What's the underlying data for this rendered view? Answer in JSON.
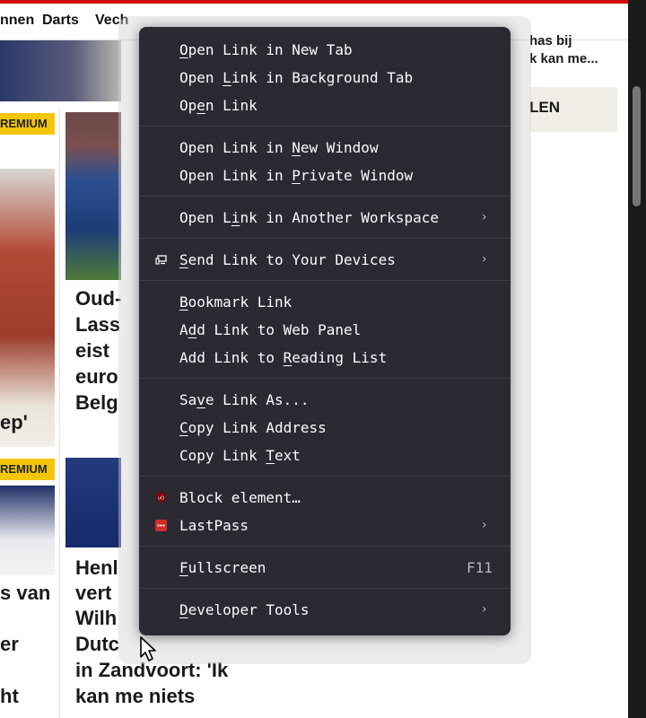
{
  "nav": {
    "items": [
      "nnen",
      "Darts",
      "Vech"
    ]
  },
  "background": {
    "premium_badge": "REMIUM",
    "premium_badge_2": "REMIUM",
    "sidebar_snippet_1": "has bij",
    "sidebar_snippet_2": "k kan me...",
    "sidebar_button_fragment": "LEN",
    "article_headline_fragments": [
      "Oud-",
      "Lass",
      "eist",
      "euro",
      "Belg"
    ],
    "left_headline_fragment": "ep'",
    "article2_headline_fragments": [
      "Henl",
      "vert",
      "Wilh",
      "Dutc",
      "in Zandvoort: 'Ik",
      "kan me niets"
    ],
    "left2_headline_fragments": [
      "s van",
      "er",
      "ht"
    ]
  },
  "context_menu": {
    "items": [
      {
        "id": "open-new-tab",
        "pre": "",
        "u": "O",
        "post": "pen Link in New Tab"
      },
      {
        "id": "open-background-tab",
        "pre": "Open ",
        "u": "L",
        "post": "ink in Background Tab"
      },
      {
        "id": "open-link",
        "pre": "Op",
        "u": "e",
        "post": "n Link"
      },
      {
        "id": "open-new-window",
        "pre": "Open Link in ",
        "u": "N",
        "post": "ew Window"
      },
      {
        "id": "open-private-window",
        "pre": "Open Link in ",
        "u": "P",
        "post": "rivate Window"
      },
      {
        "id": "open-another-workspace",
        "pre": "Open L",
        "u": "i",
        "post": "nk in Another Workspace"
      },
      {
        "id": "send-link-devices",
        "pre": "",
        "u": "S",
        "post": "end Link to Your Devices"
      },
      {
        "id": "bookmark-link",
        "pre": "",
        "u": "B",
        "post": "ookmark Link"
      },
      {
        "id": "add-web-panel",
        "pre": "A",
        "u": "d",
        "post": "d Link to Web Panel"
      },
      {
        "id": "add-reading-list",
        "pre": "Add Link to ",
        "u": "R",
        "post": "eading List"
      },
      {
        "id": "save-link-as",
        "pre": "Sa",
        "u": "v",
        "post": "e Link As..."
      },
      {
        "id": "copy-link-address",
        "pre": "",
        "u": "C",
        "post": "opy Link Address"
      },
      {
        "id": "copy-link-text",
        "pre": "Copy Link ",
        "u": "T",
        "post": "ext"
      },
      {
        "id": "block-element",
        "pre": "Block element…",
        "u": "",
        "post": ""
      },
      {
        "id": "lastpass",
        "pre": "LastPass",
        "u": "",
        "post": ""
      },
      {
        "id": "fullscreen",
        "pre": "",
        "u": "F",
        "post": "ullscreen"
      },
      {
        "id": "developer-tools",
        "pre": "",
        "u": "D",
        "post": "eveloper Tools"
      }
    ],
    "submenu_arrow": "›",
    "fullscreen_shortcut": "F11"
  },
  "icons": {
    "send-devices": "device-sync-icon",
    "block-element": "ublock-origin-icon",
    "lastpass": "lastpass-icon",
    "cursor": "mouse-pointer-icon"
  },
  "colors": {
    "menu_bg": "#2b2a33",
    "menu_text": "#fbfbfe",
    "premium_badge": "#f3c60b",
    "brand_red": "#d10a10",
    "ublock_red": "#800000",
    "lastpass_red": "#d32d27"
  }
}
